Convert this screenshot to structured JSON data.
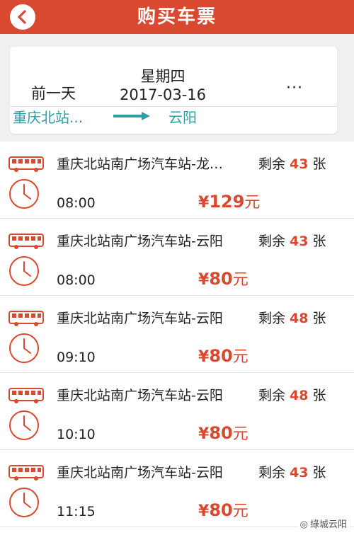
{
  "header": {
    "title": "购买车票",
    "back_icon": "chevron-left-icon"
  },
  "date_selector": {
    "prev_day": "前一天",
    "weekday": "星期四",
    "date": "2017-03-16",
    "more": "···"
  },
  "route": {
    "from": "重庆北站...",
    "to": "云阳"
  },
  "colors": {
    "brand": "#d9492f",
    "accent_teal": "#2e9ea6"
  },
  "trips": [
    {
      "station": "重庆北站南广场汽车站-龙…",
      "remain_prefix": "剩余",
      "remain": "43",
      "remain_suffix": "张",
      "time": "08:00",
      "yen": "¥",
      "price": "129",
      "unit": "元"
    },
    {
      "station": "重庆北站南广场汽车站-云阳",
      "remain_prefix": "剩余",
      "remain": "43",
      "remain_suffix": "张",
      "time": "08:00",
      "yen": "¥",
      "price": "80",
      "unit": "元"
    },
    {
      "station": "重庆北站南广场汽车站-云阳",
      "remain_prefix": "剩余",
      "remain": "48",
      "remain_suffix": "张",
      "time": "09:10",
      "yen": "¥",
      "price": "80",
      "unit": "元"
    },
    {
      "station": "重庆北站南广场汽车站-云阳",
      "remain_prefix": "剩余",
      "remain": "48",
      "remain_suffix": "张",
      "time": "10:10",
      "yen": "¥",
      "price": "80",
      "unit": "元"
    },
    {
      "station": "重庆北站南广场汽车站-云阳",
      "remain_prefix": "剩余",
      "remain": "43",
      "remain_suffix": "张",
      "time": "11:15",
      "yen": "¥",
      "price": "80",
      "unit": "元"
    }
  ],
  "watermark": {
    "text": "綠城云阳"
  }
}
